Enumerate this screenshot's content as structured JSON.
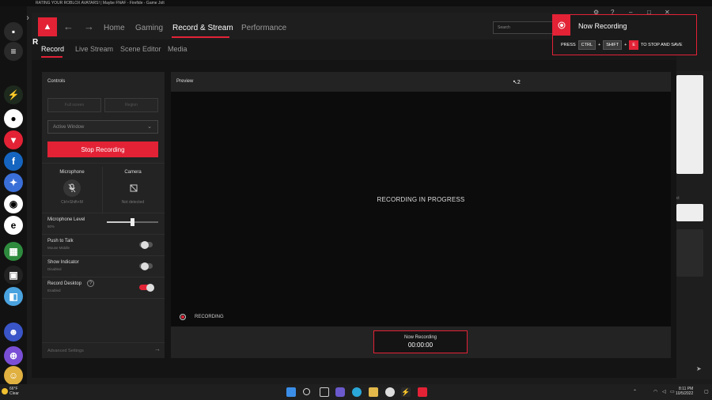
{
  "background": {
    "browser_tab_title": "RATING YOUR ROBLOX AVATARS! | Maybe FNAF - Firefide - Game Jolt",
    "right_label": "ect"
  },
  "app": {
    "logo_text": "AMD",
    "nav": [
      {
        "label": "Home"
      },
      {
        "label": "Gaming"
      },
      {
        "label": "Record & Stream"
      },
      {
        "label": "Performance"
      }
    ],
    "search_placeholder": "Search",
    "subnav": [
      {
        "label": "Record"
      },
      {
        "label": "Live Stream"
      },
      {
        "label": "Scene Editor"
      },
      {
        "label": "Media"
      }
    ],
    "partial_letter": "R"
  },
  "controls": {
    "title": "Controls",
    "full_screen_label": "Full screen",
    "region_label": "Region",
    "capture_select": "Active Window",
    "stop_button": "Stop Recording",
    "microphone": {
      "title": "Microphone",
      "shortcut": "Ctrl+Shift+M"
    },
    "camera": {
      "title": "Camera",
      "status": "Not detected"
    },
    "mic_level": {
      "label": "Microphone Level",
      "value_text": "50%",
      "value": 0.5
    },
    "push_to_talk": {
      "label": "Push to Talk",
      "sub": "Mouse Middle",
      "on": false
    },
    "show_indicator": {
      "label": "Show Indicator",
      "sub": "Disabled",
      "on": false
    },
    "record_desktop": {
      "label": "Record Desktop",
      "sub": "Enabled",
      "on": true
    },
    "advanced": "Advanced Settings"
  },
  "preview": {
    "title": "Preview",
    "cursor_label": "2",
    "status": "RECORDING IN PROGRESS",
    "rec_label": "RECORDING",
    "now_recording": "Now Recording",
    "timer": "00:00:00"
  },
  "toast": {
    "title": "Now Recording",
    "press": "PRESS",
    "key1": "CTRL",
    "key2": "SHIFT",
    "key3": "E",
    "plus": "+",
    "suffix": "TO STOP AND SAVE"
  },
  "taskbar": {
    "temperature": "66°F",
    "weather": "Clear",
    "time": "8:11 PM",
    "date": "10/5/2022"
  },
  "colors": {
    "accent": "#e32236"
  }
}
